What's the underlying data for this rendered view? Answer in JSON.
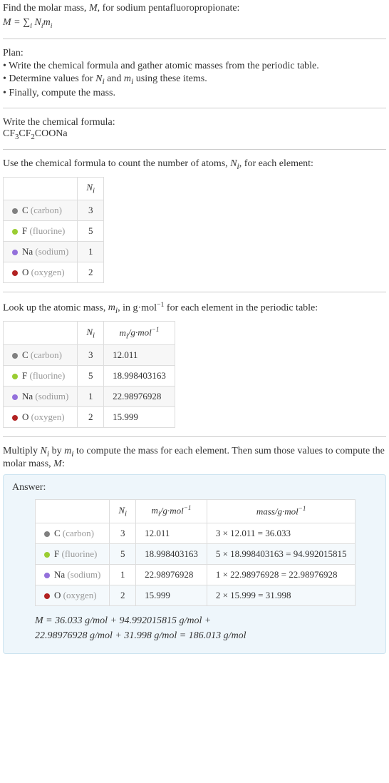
{
  "intro": {
    "line1": "Find the molar mass, M, for sodium pentafluoropropionate:",
    "formula_text": "M = ∑",
    "formula_sub": "i",
    "formula_tail": " Nᵢmᵢ"
  },
  "plan": {
    "heading": "Plan:",
    "items": [
      "Write the chemical formula and gather atomic masses from the periodic table.",
      "Determine values for Nᵢ and mᵢ using these items.",
      "Finally, compute the mass."
    ]
  },
  "step_formula": {
    "heading": "Write the chemical formula:",
    "formula": "CF₃CF₂COONa"
  },
  "step_count": {
    "heading": "Use the chemical formula to count the number of atoms, Nᵢ, for each element:",
    "header_ni": "Nᵢ",
    "rows": [
      {
        "color": "#808080",
        "symbol": "C",
        "name": "(carbon)",
        "n": "3"
      },
      {
        "color": "#9acd32",
        "symbol": "F",
        "name": "(fluorine)",
        "n": "5"
      },
      {
        "color": "#9370db",
        "symbol": "Na",
        "name": "(sodium)",
        "n": "1"
      },
      {
        "color": "#b22222",
        "symbol": "O",
        "name": "(oxygen)",
        "n": "2"
      }
    ]
  },
  "step_mass": {
    "heading": "Look up the atomic mass, mᵢ, in g·mol⁻¹ for each element in the periodic table:",
    "header_ni": "Nᵢ",
    "header_mi": "mᵢ/g·mol⁻¹",
    "rows": [
      {
        "color": "#808080",
        "symbol": "C",
        "name": "(carbon)",
        "n": "3",
        "m": "12.011"
      },
      {
        "color": "#9acd32",
        "symbol": "F",
        "name": "(fluorine)",
        "n": "5",
        "m": "18.998403163"
      },
      {
        "color": "#9370db",
        "symbol": "Na",
        "name": "(sodium)",
        "n": "1",
        "m": "22.98976928"
      },
      {
        "color": "#b22222",
        "symbol": "O",
        "name": "(oxygen)",
        "n": "2",
        "m": "15.999"
      }
    ]
  },
  "step_mult": {
    "heading": "Multiply Nᵢ by mᵢ to compute the mass for each element. Then sum those values to compute the molar mass, M:"
  },
  "answer": {
    "label": "Answer:",
    "header_ni": "Nᵢ",
    "header_mi": "mᵢ/g·mol⁻¹",
    "header_mass": "mass/g·mol⁻¹",
    "rows": [
      {
        "color": "#808080",
        "symbol": "C",
        "name": "(carbon)",
        "n": "3",
        "m": "12.011",
        "mass": "3 × 12.011 = 36.033"
      },
      {
        "color": "#9acd32",
        "symbol": "F",
        "name": "(fluorine)",
        "n": "5",
        "m": "18.998403163",
        "mass": "5 × 18.998403163 = 94.992015815"
      },
      {
        "color": "#9370db",
        "symbol": "Na",
        "name": "(sodium)",
        "n": "1",
        "m": "22.98976928",
        "mass": "1 × 22.98976928 = 22.98976928"
      },
      {
        "color": "#b22222",
        "symbol": "O",
        "name": "(oxygen)",
        "n": "2",
        "m": "15.999",
        "mass": "2 × 15.999 = 31.998"
      }
    ],
    "final": "M = 36.033 g/mol + 94.992015815 g/mol + 22.98976928 g/mol + 31.998 g/mol = 186.013 g/mol"
  }
}
